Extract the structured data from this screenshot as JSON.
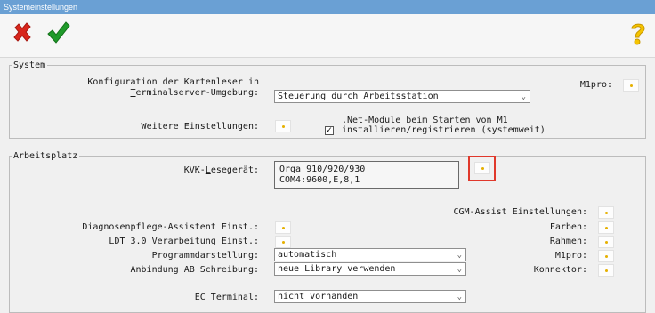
{
  "window": {
    "title": "Systemeinstellungen"
  },
  "toolbar": {
    "cancel_icon": "red-x-icon",
    "ok_icon": "green-checkmark-icon",
    "help_icon": "question-mark-icon"
  },
  "system": {
    "legend": "System",
    "kartenleser_label_1": "Konfiguration der Kartenleser in",
    "kartenleser_label_2_pre": "",
    "kartenleser_label_2_u": "T",
    "kartenleser_label_2_post": "erminalserver-Umgebung:",
    "kartenleser_value": "Steuerung durch Arbeitsstation",
    "m1pro_label": "M1pro:",
    "weitere_label": "Weitere Einstellungen:",
    "netmodule_line1": ".Net-Module beim Starten von M1",
    "netmodule_line2": "installieren/registrieren (systemweit)",
    "netmodule_checked_glyph": "✓"
  },
  "arbeitsplatz": {
    "legend": "Arbeitsplatz",
    "kvk_label_pre": "KVK-",
    "kvk_label_u": "L",
    "kvk_label_post": "esegerät:",
    "kvk_device_line1": "Orga 910/920/930",
    "kvk_device_line2": "COM4:9600,E,8,1",
    "cgm_assist_label": "CGM-Assist Einstellungen:",
    "diagnose_label": "Diagnosenpflege-Assistent Einst.:",
    "farben_label": "Farben:",
    "ldt_label": "LDT 3.0 Verarbeitung Einst.:",
    "rahmen_label": "Rahmen:",
    "programm_label": "Programmdarstellung:",
    "programm_value": "automatisch",
    "m1pro_label": "M1pro:",
    "anbindung_label": "Anbindung AB Schreibung:",
    "anbindung_value": "neue Library verwenden",
    "konnektor_label": "Konnektor:",
    "ec_label": "EC Terminal:",
    "ec_value": "nicht vorhanden"
  },
  "colors": {
    "titlebar": "#6aa0d4",
    "highlight": "#e0382b",
    "dots": "#e6b000"
  }
}
